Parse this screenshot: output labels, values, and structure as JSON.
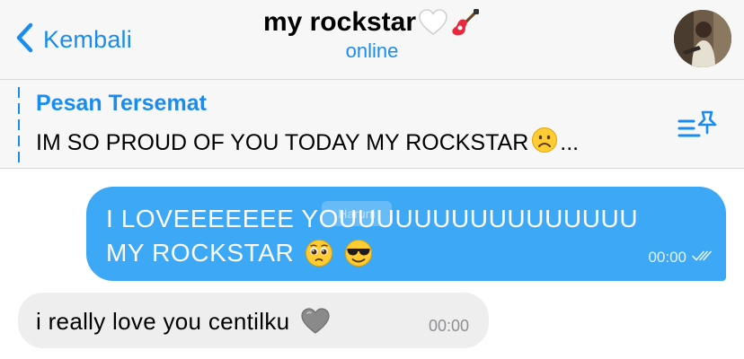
{
  "header": {
    "back_label": "Kembali",
    "title": "my rockstar",
    "status": "online",
    "title_emojis": [
      "white-heart",
      "guitar"
    ]
  },
  "pinned": {
    "title": "Pesan Tersemat",
    "text": "IM SO PROUD OF YOU TODAY MY ROCKSTAR",
    "emoji": "frowning-face",
    "ellipsis": "..."
  },
  "messages": [
    {
      "direction": "outgoing",
      "line1": "I LOVEEEEEEE YOUUUUUUUUUUUUUUUU",
      "line2": "MY ROCKSTAR",
      "emojis": [
        "pleading-face",
        "smiling-face-with-sunglasses"
      ],
      "time": "00:00",
      "read": true
    },
    {
      "direction": "incoming",
      "text": "i really love you centilku",
      "emojis": [
        "grey-heart"
      ],
      "time": "00:00"
    }
  ],
  "watermark": "Haruni",
  "colors": {
    "accent": "#1a8cf0",
    "outgoing_bubble": "#3da8f5",
    "incoming_bubble": "#eeeeee",
    "header_bg": "#f7f7f7"
  }
}
